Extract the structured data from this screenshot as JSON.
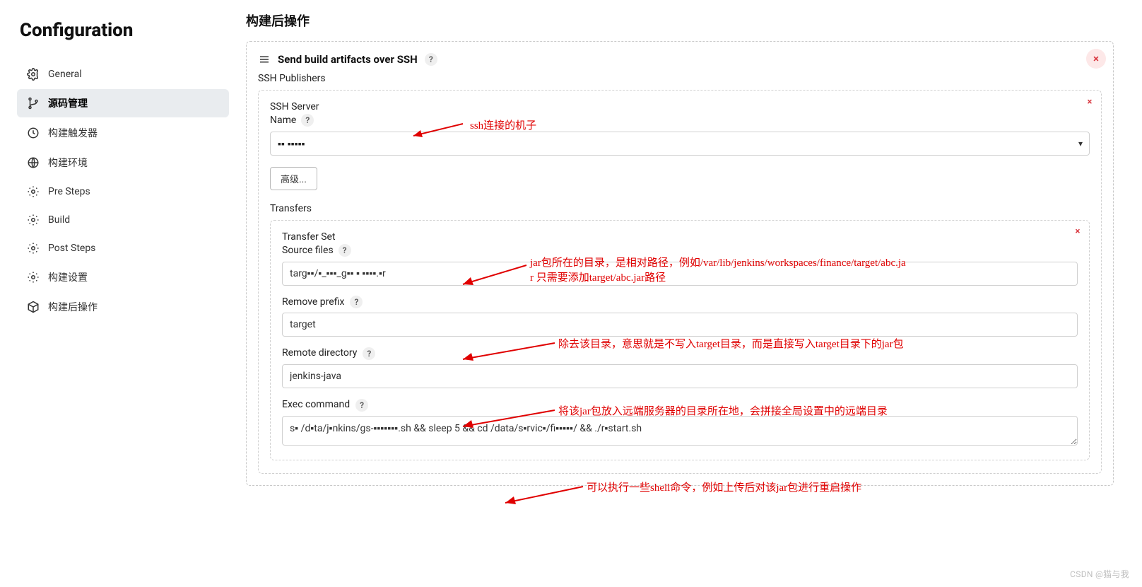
{
  "sidebar": {
    "title": "Configuration",
    "items": [
      {
        "label": "General"
      },
      {
        "label": "源码管理"
      },
      {
        "label": "构建触发器"
      },
      {
        "label": "构建环境"
      },
      {
        "label": "Pre Steps"
      },
      {
        "label": "Build"
      },
      {
        "label": "Post Steps"
      },
      {
        "label": "构建设置"
      },
      {
        "label": "构建后操作"
      }
    ]
  },
  "main": {
    "section_title": "构建后操作",
    "step_title": "Send build artifacts over SSH",
    "ssh_publishers_label": "SSH Publishers",
    "close_x": "×",
    "ssh_server": {
      "label_line1": "SSH Server",
      "label_line2": "Name",
      "value": "▪▪ ▪▪▪▪▪"
    },
    "advanced_btn": "高级...",
    "transfers_label": "Transfers",
    "transfer_set": {
      "label_line1": "Transfer Set",
      "label_line2": "Source files",
      "source_files_value": "targ▪▪/▪_▪▪▪_g▪▪ ▪ ▪▪▪▪.▪r",
      "remove_prefix_label": "Remove prefix",
      "remove_prefix_value": "target",
      "remote_dir_label": "Remote directory",
      "remote_dir_value": "jenkins-java",
      "exec_cmd_label": "Exec command",
      "exec_cmd_value": "s▪ /d▪ta/j▪nkins/gs-▪▪▪▪▪▪▪.sh && sleep 5 && cd /data/s▪rvic▪/fi▪▪▪▪▪/ && ./r▪start.sh"
    },
    "help": "?"
  },
  "annotations": {
    "a1": "ssh连接的机子",
    "a2_l1": "jar包所在的目录，是相对路径，例如/var/lib/jenkins/workspaces/finance/target/abc.ja",
    "a2_l2": "r  只需要添加target/abc.jar路径",
    "a3": "除去该目录，意思就是不写入target目录，而是直接写入target目录下的jar包",
    "a4": "将该jar包放入远端服务器的目录所在地，会拼接全局设置中的远端目录",
    "a5": "可以执行一些shell命令，例如上传后对该jar包进行重启操作"
  },
  "watermark": "CSDN @猫与我"
}
